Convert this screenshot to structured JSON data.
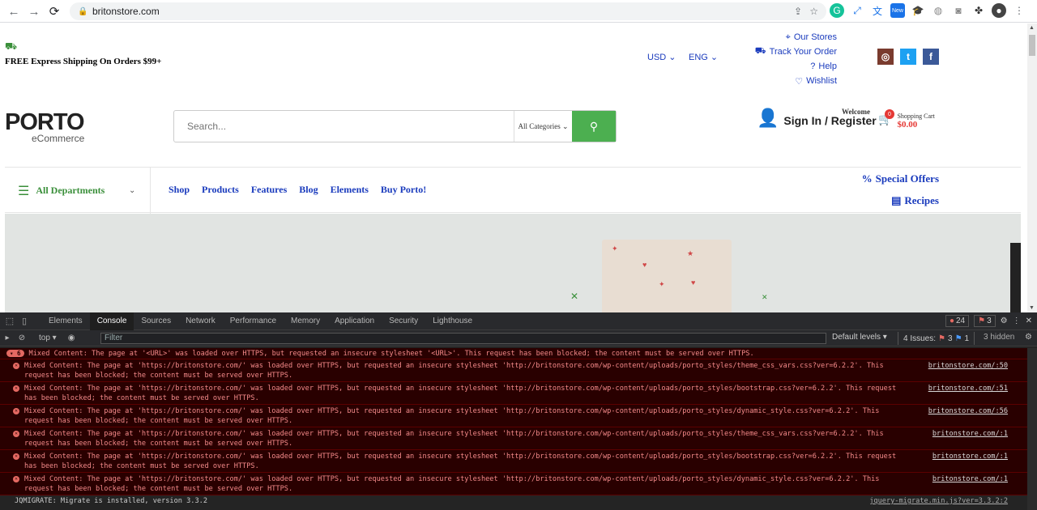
{
  "browser": {
    "url": "britonstore.com",
    "back": "←",
    "forward": "→",
    "reload": "⟳"
  },
  "header": {
    "shipping": "FREE Express Shipping On Orders $99+",
    "currency": "USD",
    "language": "ENG",
    "links": [
      "Our Stores",
      "Track Your Order",
      "Help",
      "Wishlist"
    ],
    "social": [
      "instagram-icon",
      "twitter-icon",
      "facebook-icon"
    ],
    "logo_main": "PORTO",
    "logo_sub": "eCommerce",
    "search_placeholder": "Search...",
    "category": "All Categories",
    "welcome": "Welcome",
    "signin": "Sign In / Register",
    "cart_label": "Shopping Cart",
    "cart_total": "$0.00",
    "cart_count": "0"
  },
  "menu": {
    "departments": "All Departments",
    "items": [
      "Shop",
      "Products",
      "Features",
      "Blog",
      "Elements",
      "Buy Porto!"
    ],
    "special_offers": "Special Offers",
    "recipes": "Recipes"
  },
  "colors": {
    "accent_green": "#4caf50",
    "link_blue": "#1a3bbd",
    "error_red": "#f48a8a"
  },
  "devtools": {
    "tabs": [
      "Elements",
      "Console",
      "Sources",
      "Network",
      "Performance",
      "Memory",
      "Application",
      "Security",
      "Lighthouse"
    ],
    "error_count": "24",
    "warning_count": "3",
    "context": "top",
    "filter_placeholder": "Filter",
    "levels": "Default levels",
    "issues_label": "4 Issues:",
    "issues_err": "3",
    "issues_info": "1",
    "hidden": "3 hidden",
    "group_count": "6",
    "group_msg": "Mixed Content: The page at '<URL>' was loaded over HTTPS, but requested an insecure stylesheet '<URL>'. This request has been blocked; the content must be served over HTTPS.",
    "messages": [
      {
        "l1": "Mixed Content: The page at 'https://britonstore.com/' was loaded over HTTPS, but requested an insecure stylesheet 'http://britonstore.com/wp-content/uploads/porto_styles/theme_css_vars.css?ver=6.2.2'. This",
        "l2": "request has been blocked; the content must be served over HTTPS.",
        "src": "britonstore.com/:50"
      },
      {
        "l1": "Mixed Content: The page at 'https://britonstore.com/' was loaded over HTTPS, but requested an insecure stylesheet 'http://britonstore.com/wp-content/uploads/porto_styles/bootstrap.css?ver=6.2.2'. This request",
        "l2": "has been blocked; the content must be served over HTTPS.",
        "src": "britonstore.com/:51"
      },
      {
        "l1": "Mixed Content: The page at 'https://britonstore.com/' was loaded over HTTPS, but requested an insecure stylesheet 'http://britonstore.com/wp-content/uploads/porto_styles/dynamic_style.css?ver=6.2.2'. This",
        "l2": "request has been blocked; the content must be served over HTTPS.",
        "src": "britonstore.com/:56"
      },
      {
        "l1": "Mixed Content: The page at 'https://britonstore.com/' was loaded over HTTPS, but requested an insecure stylesheet 'http://britonstore.com/wp-content/uploads/porto_styles/theme_css_vars.css?ver=6.2.2'. This",
        "l2": "request has been blocked; the content must be served over HTTPS.",
        "src": "britonstore.com/:1"
      },
      {
        "l1": "Mixed Content: The page at 'https://britonstore.com/' was loaded over HTTPS, but requested an insecure stylesheet 'http://britonstore.com/wp-content/uploads/porto_styles/bootstrap.css?ver=6.2.2'. This request",
        "l2": "has been blocked; the content must be served over HTTPS.",
        "src": "britonstore.com/:1"
      },
      {
        "l1": "Mixed Content: The page at 'https://britonstore.com/' was loaded over HTTPS, but requested an insecure stylesheet 'http://britonstore.com/wp-content/uploads/porto_styles/dynamic_style.css?ver=6.2.2'. This",
        "l2": "request has been blocked; the content must be served over HTTPS.",
        "src": "britonstore.com/:1"
      }
    ],
    "info_msg": "JQMIGRATE: Migrate is installed, version 3.3.2",
    "info_src": "jquery-migrate.min.js?ver=3.3.2:2"
  }
}
